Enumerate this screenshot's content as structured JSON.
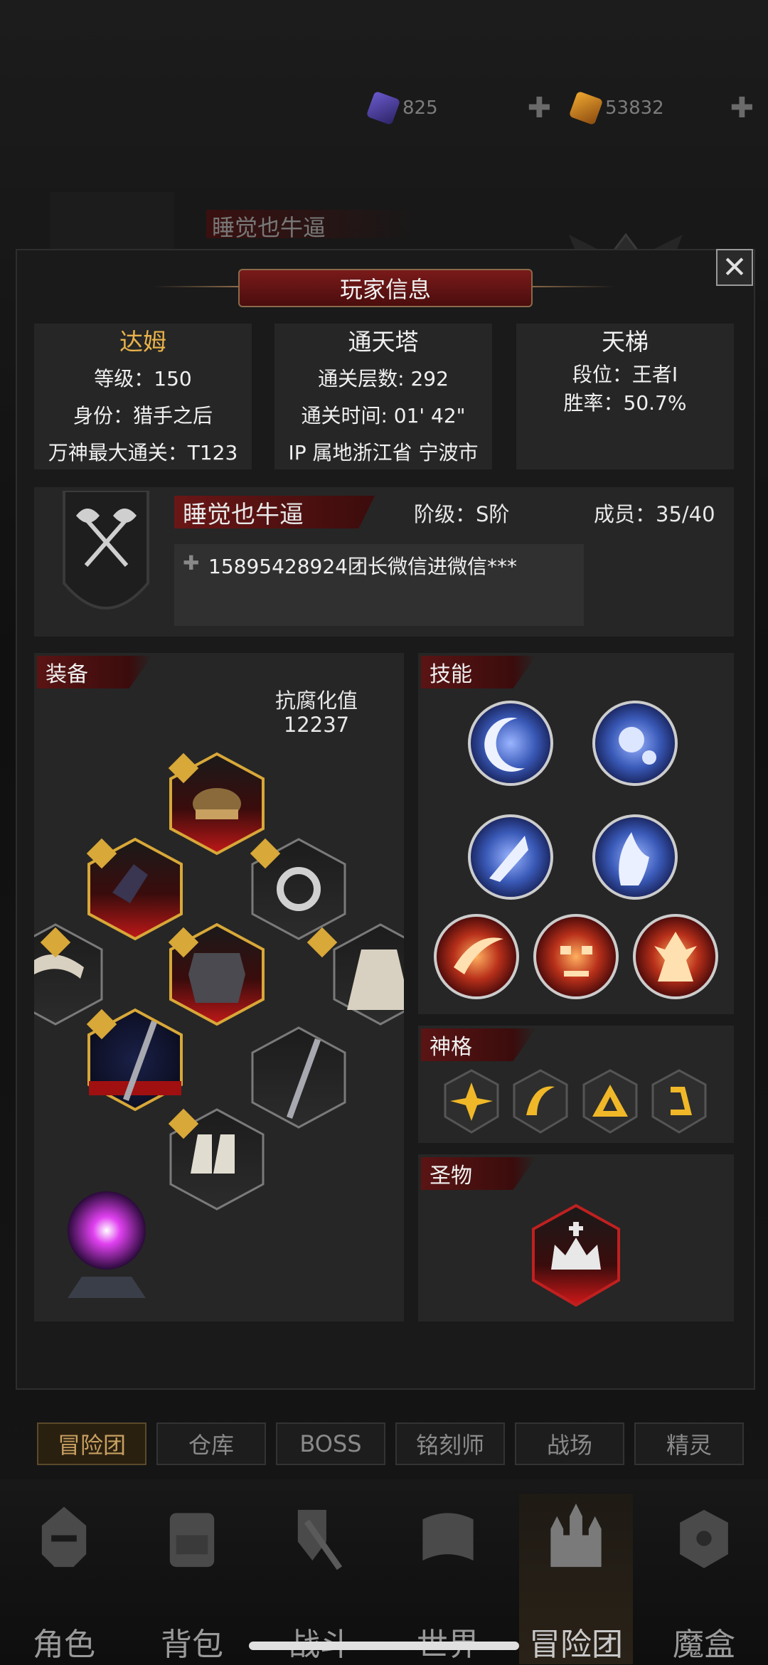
{
  "resources": [
    {
      "name": "gem-purple",
      "value": "825"
    },
    {
      "name": "gem-gold",
      "value": "53832"
    }
  ],
  "modal": {
    "title": "玩家信息",
    "character": {
      "name": "达姆",
      "level": "等级：150",
      "identity": "身份：猎手之后",
      "pantheon": "万神最大通关：T123"
    },
    "tower": {
      "title": "通天塔",
      "floors": "通关层数: 292",
      "time": "通关时间: 01' 42\"",
      "ip": "IP 属地浙江省 宁波市"
    },
    "ladder": {
      "title": "天梯",
      "rank": "段位：王者I",
      "winrate": "胜率：50.7%"
    },
    "guild": {
      "name": "睡觉也牛逼",
      "tier": "阶级：S阶",
      "members": "成员：35/40",
      "notice": "15895428924团长微信进微信***"
    },
    "equipment": {
      "label": "装备",
      "corruption_label": "抗腐化值",
      "corruption_value": "12237"
    },
    "skills": {
      "label": "技能"
    },
    "divinity": {
      "label": "神格"
    },
    "relic": {
      "label": "圣物"
    }
  },
  "tabs": [
    "冒险团",
    "仓库",
    "BOSS",
    "铭刻师",
    "战场",
    "精灵"
  ],
  "nav": [
    "角色",
    "背包",
    "战斗",
    "世界",
    "冒险团",
    "魔盒"
  ],
  "colors": {
    "accent_red": "#7a1a1a",
    "gold": "#e8b24a",
    "skill_blue": "#3a5ab8",
    "skill_red": "#b8301a"
  }
}
